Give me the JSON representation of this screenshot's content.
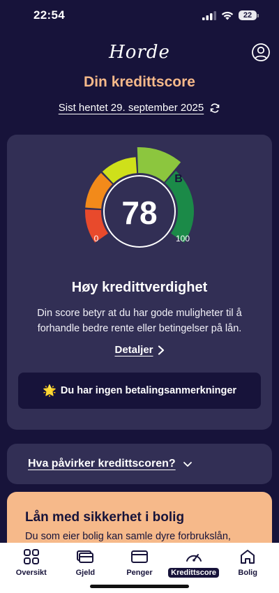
{
  "status_bar": {
    "time": "22:54",
    "battery": "22"
  },
  "header": {
    "logo": "Horde"
  },
  "page": {
    "title": "Din kredittscore",
    "fetched": "Sist hentet 29. september 2025"
  },
  "score_card": {
    "score": "78",
    "grade": "B",
    "min": "0",
    "max": "100",
    "heading": "Høy kredittverdighet",
    "description": "Din score betyr at du har gode muligheter til å forhandle bedre rente eller betingelser på lån.",
    "details_label": "Detaljer",
    "remarks_icon": "🌟",
    "remarks_text": "Du har ingen betalingsanmerkninger",
    "gauge_colors": [
      "#e84a2c",
      "#f28a1a",
      "#cfe01a",
      "#8cc63e",
      "#1b8a48"
    ]
  },
  "influence": {
    "label": "Hva påvirker kredittscoren?"
  },
  "loan_card": {
    "title": "Lån med sikkerhet i bolig",
    "text": "Du som eier bolig kan samle dyre forbrukslån,"
  },
  "tabs": [
    {
      "label": "Oversikt",
      "icon": "grid-icon",
      "active": false
    },
    {
      "label": "Gjeld",
      "icon": "cards-icon",
      "active": false
    },
    {
      "label": "Penger",
      "icon": "wallet-icon",
      "active": false
    },
    {
      "label": "Kredittscore",
      "icon": "speedometer-icon",
      "active": true
    },
    {
      "label": "Bolig",
      "icon": "home-icon",
      "active": false
    }
  ],
  "colors": {
    "background": "#17133a",
    "card": "#322f55",
    "accent": "#f6b98a"
  }
}
